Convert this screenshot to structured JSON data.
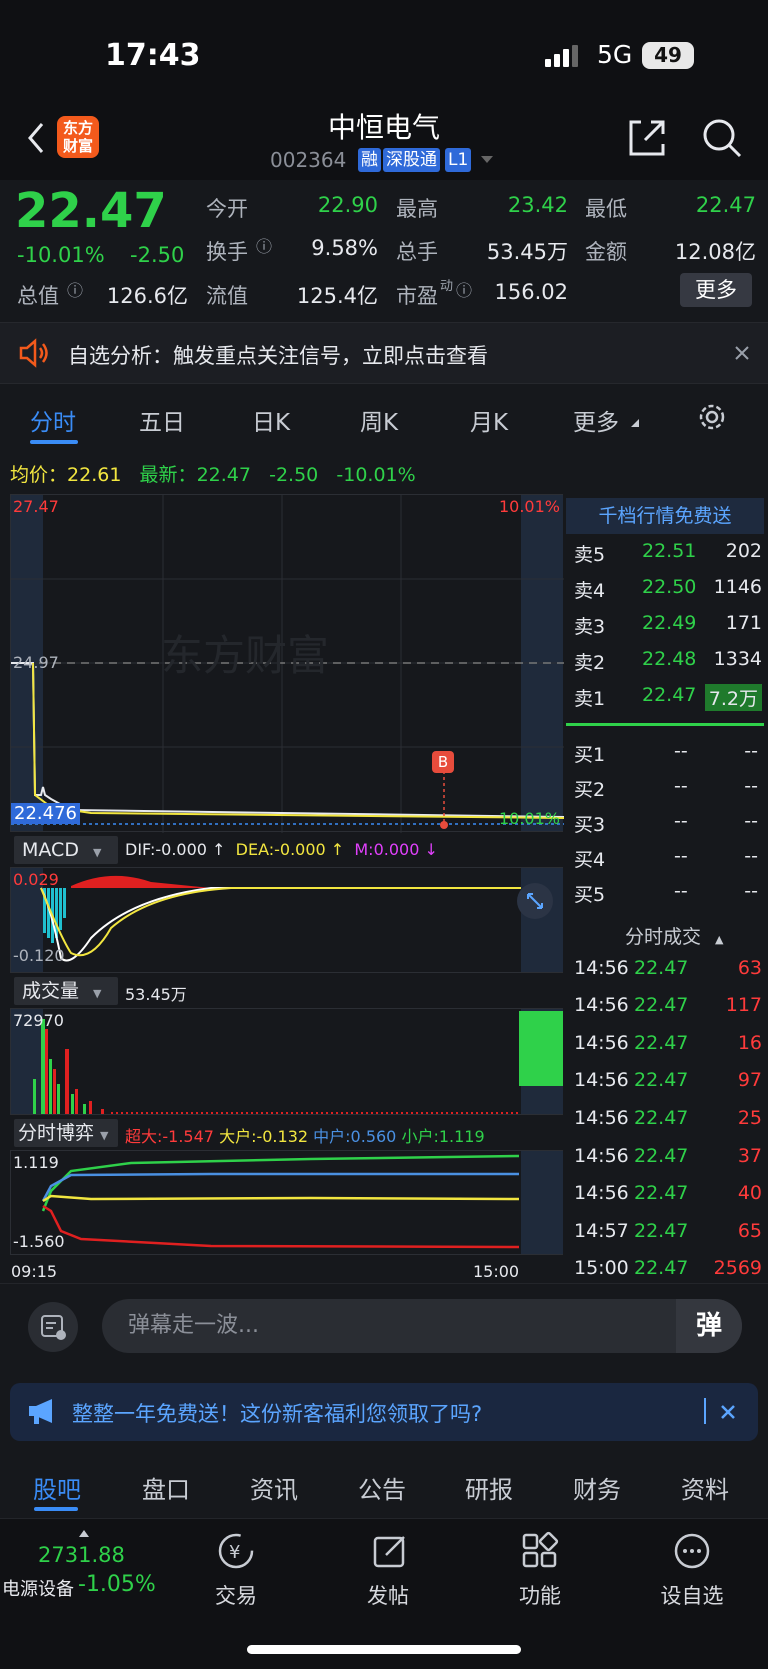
{
  "status": {
    "time": "17:43",
    "network": "5G",
    "battery": "49"
  },
  "header": {
    "stock_name": "中恒电气",
    "code": "002364",
    "tags": [
      "融",
      "深股通",
      "L1"
    ],
    "logo_text": "东方\n财富"
  },
  "quote": {
    "price": "22.47",
    "change_pct": "-10.01%",
    "change": "-2.50",
    "open_label": "今开",
    "open": "22.90",
    "high_label": "最高",
    "high": "23.42",
    "low_label": "最低",
    "low": "22.47",
    "turnover_label": "换手",
    "turnover": "9.58%",
    "vol_label": "总手",
    "vol": "53.45万",
    "amount_label": "金额",
    "amount": "12.08亿",
    "mcap_label": "总值",
    "mcap": "126.6亿",
    "float_label": "流值",
    "float": "125.4亿",
    "pe_label": "市盈",
    "pe_sup": "动",
    "pe": "156.02",
    "more_button": "更多"
  },
  "notice": {
    "text": "自选分析：触发重点关注信号，立即点击查看"
  },
  "tabs": [
    "分时",
    "五日",
    "日K",
    "周K",
    "月K",
    "更多"
  ],
  "summary": {
    "avg_label": "均价：",
    "avg": "22.61",
    "latest_label": "最新：",
    "latest": "22.47",
    "chg": "-2.50",
    "pct": "-10.01%"
  },
  "intraday": {
    "y_top": "27.47",
    "y_mid": "24.97",
    "current_tag": "22.476",
    "pct_top": "10.01%",
    "pct_bottom": "10.01%",
    "watermark": "东方财富",
    "marker": "B",
    "time_start": "09:15",
    "time_end": "15:00"
  },
  "macd": {
    "name": "MACD",
    "dif": "DIF:-0.000 ↑",
    "dea": "DEA:-0.000 ↑",
    "m": "M:0.000 ↓",
    "y_top": "0.029",
    "y_bottom": "-0.120"
  },
  "volume": {
    "name": "成交量",
    "value": "53.45万",
    "y_top": "72970"
  },
  "flow": {
    "name": "分时博弈",
    "super": "超大:-1.547",
    "large": "大户:-0.132",
    "mid": "中户:0.560",
    "small": "小户:1.119",
    "y_top": "1.119",
    "y_bottom": "-1.560"
  },
  "book": {
    "ad": "千档行情免费送",
    "asks": [
      {
        "label": "卖5",
        "price": "22.51",
        "vol": "202"
      },
      {
        "label": "卖4",
        "price": "22.50",
        "vol": "1146"
      },
      {
        "label": "卖3",
        "price": "22.49",
        "vol": "171"
      },
      {
        "label": "卖2",
        "price": "22.48",
        "vol": "1334"
      },
      {
        "label": "卖1",
        "price": "22.47",
        "vol": "7.2万"
      }
    ],
    "bids": [
      {
        "label": "买1",
        "price": "--",
        "vol": "--"
      },
      {
        "label": "买2",
        "price": "--",
        "vol": "--"
      },
      {
        "label": "买3",
        "price": "--",
        "vol": "--"
      },
      {
        "label": "买4",
        "price": "--",
        "vol": "--"
      },
      {
        "label": "买5",
        "price": "--",
        "vol": "--"
      }
    ],
    "trades_title": "分时成交",
    "trades": [
      {
        "t": "14:56",
        "p": "22.47",
        "v": "63"
      },
      {
        "t": "14:56",
        "p": "22.47",
        "v": "117"
      },
      {
        "t": "14:56",
        "p": "22.47",
        "v": "16"
      },
      {
        "t": "14:56",
        "p": "22.47",
        "v": "97"
      },
      {
        "t": "14:56",
        "p": "22.47",
        "v": "25"
      },
      {
        "t": "14:56",
        "p": "22.47",
        "v": "37"
      },
      {
        "t": "14:56",
        "p": "22.47",
        "v": "40"
      },
      {
        "t": "14:57",
        "p": "22.47",
        "v": "65"
      },
      {
        "t": "15:00",
        "p": "22.47",
        "v": "2569"
      }
    ]
  },
  "danmaku": {
    "placeholder": "弹幕走一波...",
    "button": "弹"
  },
  "promo": {
    "text": "整整一年免费送！这份新客福利您领取了吗?"
  },
  "bottom_tabs": [
    "股吧",
    "盘口",
    "资讯",
    "公告",
    "研报",
    "财务",
    "资料"
  ],
  "footer": {
    "index_value": "2731.88",
    "index_name": "电源设备",
    "index_pct": "-1.05%",
    "items": [
      "交易",
      "发帖",
      "功能",
      "设自选"
    ]
  }
}
